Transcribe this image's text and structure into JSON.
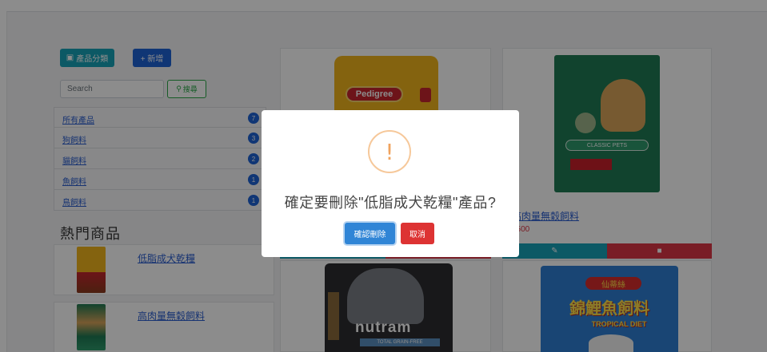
{
  "sidebar": {
    "category_button": "產品分類",
    "new_button": "+ 新增",
    "search_placeholder": "Search",
    "search_button": "搜尋",
    "categories": [
      {
        "label": "所有產品",
        "count": "7"
      },
      {
        "label": "狗飼料",
        "count": "3"
      },
      {
        "label": "貓飼料",
        "count": "2"
      },
      {
        "label": "魚飼料",
        "count": "1"
      },
      {
        "label": "鳥飼料",
        "count": "1"
      }
    ]
  },
  "hot": {
    "title": "熱門商品",
    "items": [
      {
        "name": "低脂成犬乾糧"
      },
      {
        "name": "高肉量無穀飼料"
      }
    ]
  },
  "products": {
    "pedigree_logo": "Pedigree",
    "classic_banner": "CLASSIC PETS",
    "card2_name": "高肉量無穀飼料",
    "card2_price": "$500",
    "nutram_brand": "nutram",
    "nutram_strip": "TOTAL  GRAIN-FREE",
    "fish_top": "仙蒂絲",
    "fish_main": "錦鯉魚飼料",
    "fish_sub": "TROPICAL DIET"
  },
  "modal": {
    "icon": "!",
    "title": "確定要刪除\"低脂成犬乾糧\"產品?",
    "confirm": "確認刪除",
    "cancel": "取消"
  },
  "colors": {
    "info": "#17a2b8",
    "primary": "#1e63d6",
    "danger": "#dc3545",
    "warning_icon": "#f0a35e"
  }
}
